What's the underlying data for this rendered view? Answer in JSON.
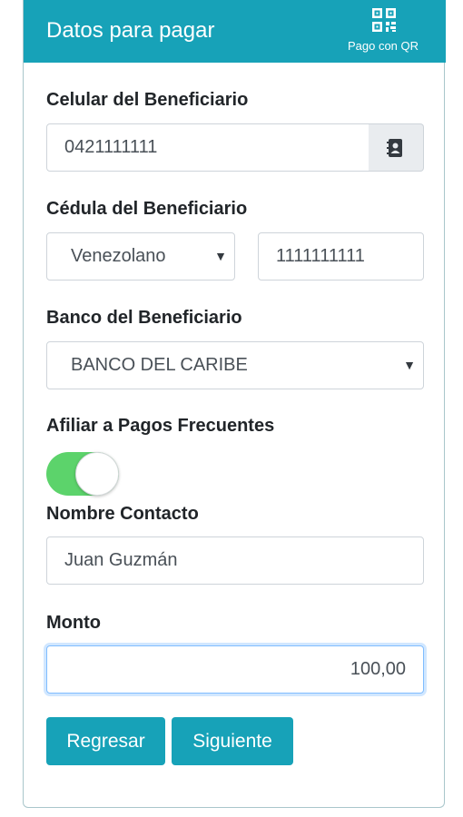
{
  "header": {
    "title": "Datos para pagar",
    "qr_label": "Pago con QR",
    "qr_icon": "qr-code-icon",
    "color": "#17a2b8"
  },
  "celular": {
    "label": "Celular del Beneficiario",
    "value": "0421111111",
    "addon_icon": "contact-book-icon"
  },
  "cedula": {
    "label": "Cédula del Beneficiario",
    "nationality": "Venezolano",
    "number": "1111111111"
  },
  "banco": {
    "label": "Banco del Beneficiario",
    "selected": "BANCO DEL CARIBE"
  },
  "afiliar": {
    "label": "Afiliar a Pagos Frecuentes",
    "enabled": true,
    "toggle_color": "#5cd36b"
  },
  "contacto": {
    "label": "Nombre Contacto",
    "value": "Juan Guzmán"
  },
  "monto": {
    "label": "Monto",
    "value": "100,00"
  },
  "buttons": {
    "back": "Regresar",
    "next": "Siguiente"
  }
}
